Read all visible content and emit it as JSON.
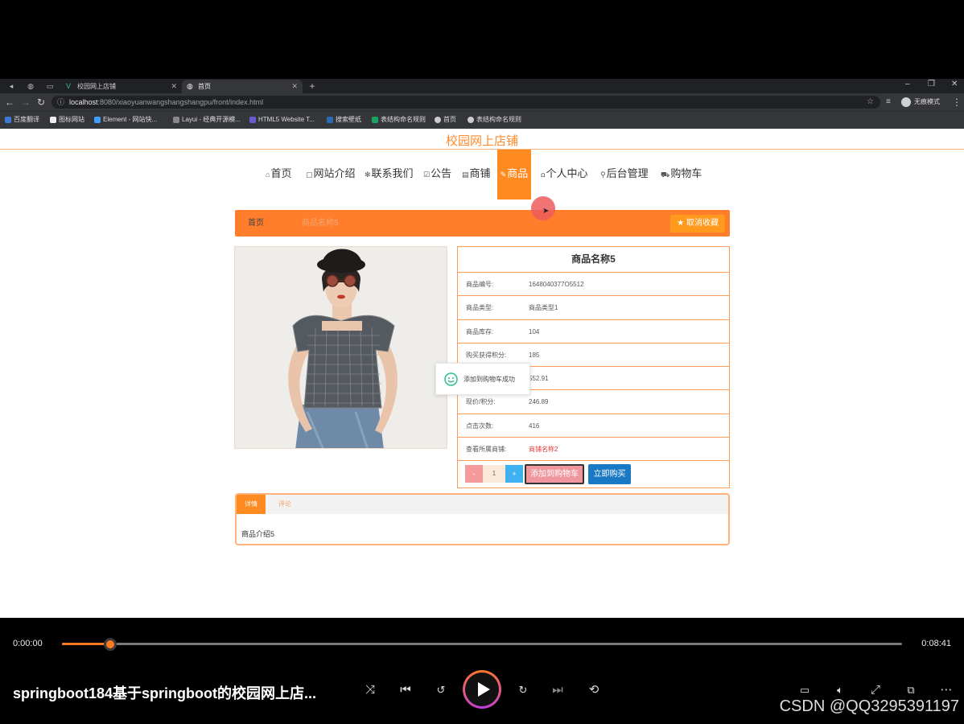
{
  "browser": {
    "tabs": [
      {
        "title": "校园网上店铺",
        "active": false
      },
      {
        "title": "首页",
        "active": true
      }
    ],
    "url_host": "localhost",
    "url_rest": ":8080/xiaoyuanwangshangshangpu/front/index.html",
    "profile": "无痕模式",
    "bookmarks": [
      "百度翻译",
      "图标网站",
      "Element - 网站快...",
      "Layui - 经典开源模...",
      "HTML5 Website T...",
      "搜索壁纸",
      "表结构命名规则",
      "首页",
      "表结构命名规则"
    ]
  },
  "site": {
    "title": "校园网上店铺",
    "menu": [
      {
        "icon": "⌂",
        "label": "首页"
      },
      {
        "icon": "▢",
        "label": "网站介绍"
      },
      {
        "icon": "✻",
        "label": "联系我们"
      },
      {
        "icon": "☑",
        "label": "公告"
      },
      {
        "icon": "▤",
        "label": "商铺"
      },
      {
        "icon": "✎",
        "label": "商品",
        "active": true
      },
      {
        "icon": "ꭥ",
        "label": "个人中心"
      },
      {
        "icon": "⚲",
        "label": "后台管理"
      },
      {
        "icon": "⛟",
        "label": "购物车"
      }
    ]
  },
  "breadcrumb": {
    "home": "首页",
    "current": "商品名称5",
    "favorite_label": "★ 取消收藏"
  },
  "product": {
    "name": "商品名称5",
    "fields": [
      {
        "key": "商品编号:",
        "value": "1648040377O5512"
      },
      {
        "key": "商品类型:",
        "value": "商品类型1"
      },
      {
        "key": "商品库存:",
        "value": "104"
      },
      {
        "key": "购买获得积分:",
        "value": "185"
      },
      {
        "key": "",
        "value": "552.91"
      },
      {
        "key": "现价/积分:",
        "value": "246.89"
      },
      {
        "key": "点击次数:",
        "value": "416"
      },
      {
        "key": "查看所属商铺:",
        "value": "商铺名称2",
        "link": true
      }
    ],
    "quantity": "1",
    "minus": "-",
    "plus": "+",
    "add_to_cart": "添加到购物车",
    "buy_now": "立即购买"
  },
  "toast": {
    "message": "添加到购物车成功"
  },
  "detail": {
    "tabs": [
      "详情",
      "评论"
    ],
    "body": "商品介绍5"
  },
  "player": {
    "current_time": "0:00:00",
    "total_time": "0:08:41",
    "progress": 0.057,
    "title": "springboot184基于springboot的校园网上店...",
    "watermark": "CSDN @QQ3295391197",
    "accent": "#ff7a21"
  }
}
